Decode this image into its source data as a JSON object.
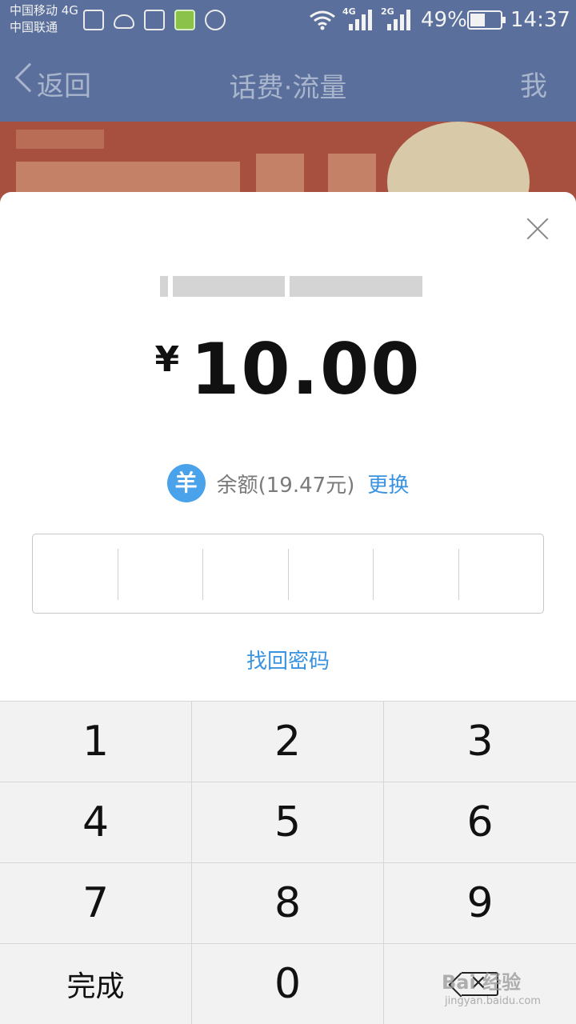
{
  "status_bar": {
    "carrier_1": "中国移动 4G",
    "carrier_2": "中国联通",
    "net_1": "4G",
    "net_2": "2G",
    "battery": "49%",
    "time": "14:37"
  },
  "nav": {
    "back_label": "返回",
    "title": "话费·流量",
    "right_label": "我"
  },
  "payment": {
    "currency_symbol": "¥",
    "amount": "10.00",
    "method_icon_glyph": "羊",
    "balance_text": "余额(19.47元)",
    "change_label": "更换",
    "pin_length": 6,
    "forgot_password_label": "找回密码"
  },
  "keypad": {
    "keys": [
      "1",
      "2",
      "3",
      "4",
      "5",
      "6",
      "7",
      "8",
      "9"
    ],
    "done_label": "完成",
    "zero_label": "0"
  },
  "watermark": {
    "text": "Bai 经验",
    "url": "jingyan.baidu.com"
  },
  "colors": {
    "accent": "#3a93e0",
    "method_icon_bg": "#4aa3ea",
    "overlay_header": "#5a6f9b",
    "keypad_bg": "#f2f2f2"
  }
}
